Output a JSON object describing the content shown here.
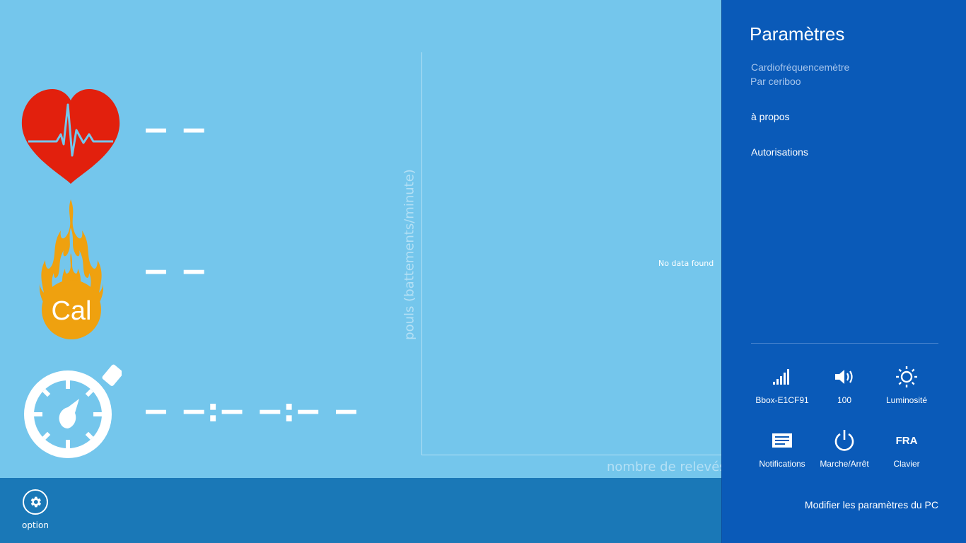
{
  "dashboard": {
    "heart_rate_value": "– –",
    "calories_value": "– –",
    "timer_value": "– –:– –:– –",
    "calorie_badge": "Cal"
  },
  "chart_data": {
    "type": "line",
    "ylabel": "pouls (battements/minute)",
    "xlabel": "nombre de relevés",
    "empty_message": "No data found",
    "series": []
  },
  "app_bar": {
    "option_label": "option",
    "option_icon": "gear-icon"
  },
  "settings_pane": {
    "title": "Paramètres",
    "app_name": "Cardiofréquencemètre",
    "author": "Par ceriboo",
    "links": [
      {
        "label": "à propos"
      },
      {
        "label": "Autorisations"
      }
    ],
    "tiles": [
      {
        "label": "Bbox-E1CF91",
        "icon": "wifi-signal-icon"
      },
      {
        "label": "100",
        "icon": "volume-icon"
      },
      {
        "label": "Luminosité",
        "icon": "brightness-icon"
      },
      {
        "label": "Notifications",
        "icon": "notifications-icon"
      },
      {
        "label": "Marche/Arrêt",
        "icon": "power-icon"
      },
      {
        "label": "Clavier",
        "icon": "keyboard-language",
        "glyph": "FRA"
      }
    ],
    "pc_settings_label": "Modifier les paramètres du PC"
  },
  "colors": {
    "app_background": "#74c6ec",
    "app_bar": "#1a78b7",
    "settings_pane": "#0a5ab8",
    "heart": "#e2200d",
    "flame": "#efa10f"
  }
}
